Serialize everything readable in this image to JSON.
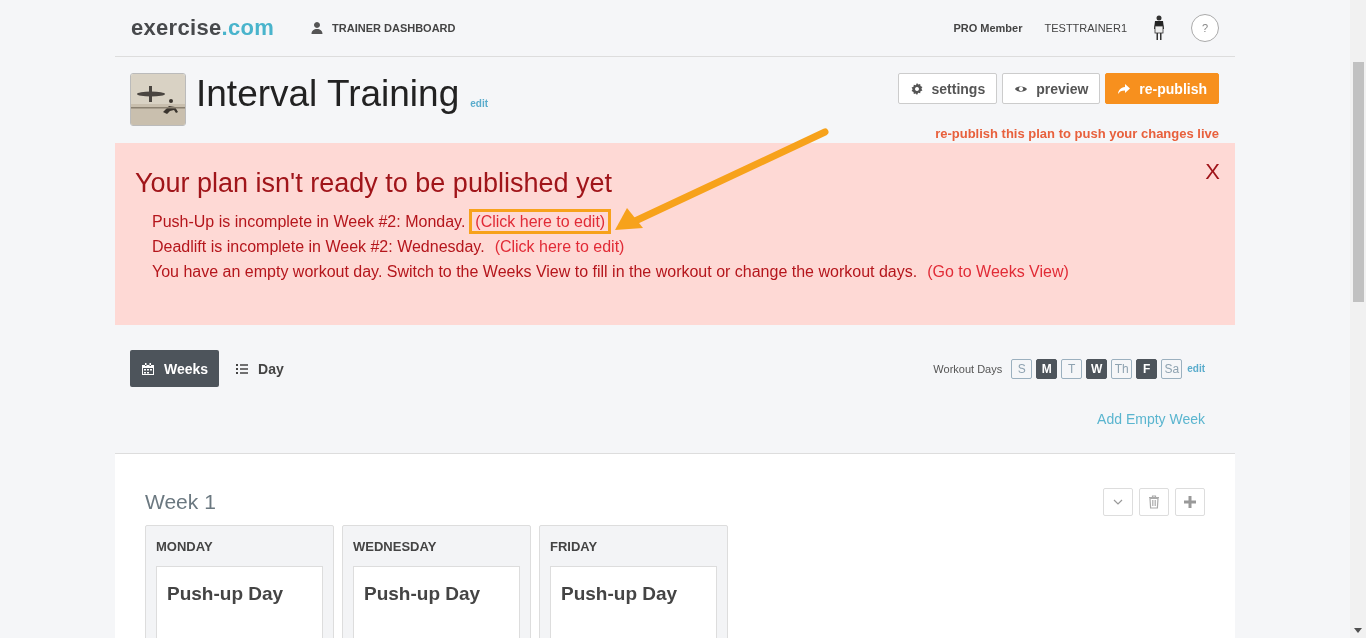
{
  "header": {
    "logo": {
      "name": "exercise",
      "suffix": ".com"
    },
    "nav": "TRAINER DASHBOARD",
    "membership": "PRO Member",
    "username": "TESTTRAINER1",
    "help": "?"
  },
  "plan": {
    "title": "Interval Training",
    "edit": "edit",
    "buttons": [
      {
        "label": "settings",
        "kind": "settings"
      },
      {
        "label": "preview",
        "kind": "preview"
      },
      {
        "label": "re-publish",
        "kind": "publish"
      }
    ],
    "notice": "re-publish this plan to push your changes live"
  },
  "alert": {
    "title": "Your plan isn't ready to be published yet",
    "close": "X",
    "messages": [
      {
        "text": "Push-Up is incomplete in Week #2: Monday.",
        "link": "(Click here to edit)",
        "highlighted": true
      },
      {
        "text": "Deadlift is incomplete in Week #2: Wednesday.",
        "link": "(Click here to edit)",
        "highlighted": false
      },
      {
        "text": "You have an empty workout day. Switch to the Weeks View to fill in the workout or change the workout days.",
        "link": "(Go to Weeks View)",
        "highlighted": false
      }
    ]
  },
  "views": [
    {
      "label": "Weeks",
      "kind": "calendar",
      "selected": true
    },
    {
      "label": "Day",
      "kind": "list",
      "selected": false
    }
  ],
  "workout_days": {
    "label": "Workout Days",
    "edit": "edit",
    "days": [
      {
        "label": "S",
        "on": false
      },
      {
        "label": "M",
        "on": true
      },
      {
        "label": "T",
        "on": false
      },
      {
        "label": "W",
        "on": true
      },
      {
        "label": "Th",
        "on": false
      },
      {
        "label": "F",
        "on": true
      },
      {
        "label": "Sa",
        "on": false
      }
    ]
  },
  "add_week": "Add Empty Week",
  "weeks": [
    {
      "title": "Week 1",
      "days": [
        {
          "name": "MONDAY",
          "workout": "Push-up Day"
        },
        {
          "name": "WEDNESDAY",
          "workout": "Push-up Day"
        },
        {
          "name": "FRIDAY",
          "workout": "Push-up Day"
        }
      ]
    }
  ]
}
